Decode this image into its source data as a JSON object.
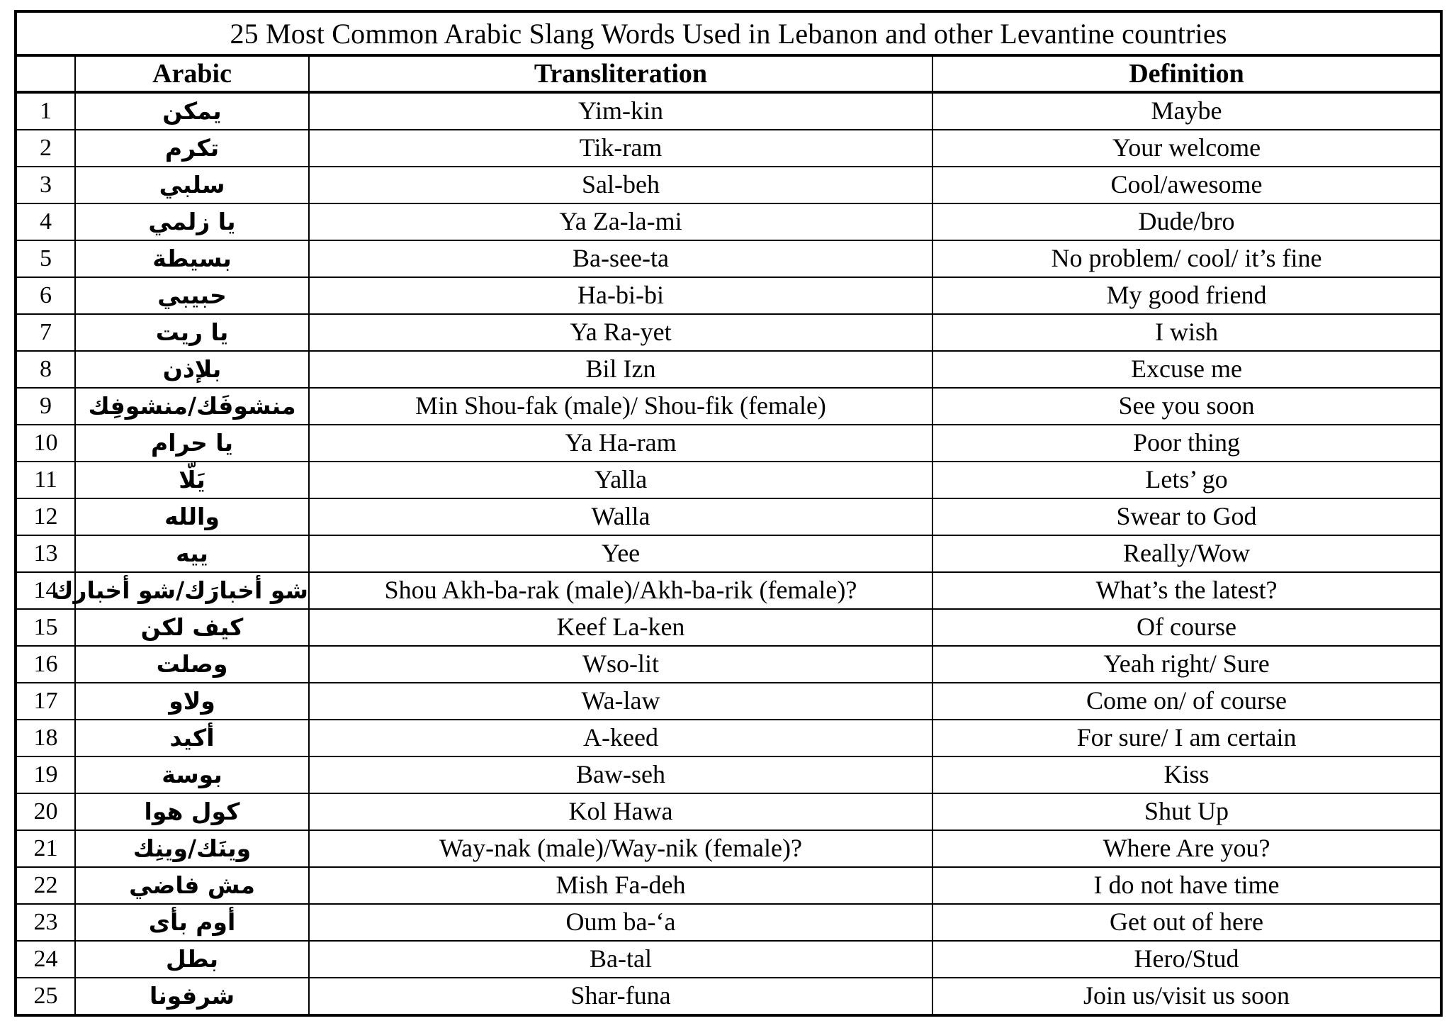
{
  "document": {
    "title": "25 Most Common Arabic Slang Words Used in Lebanon and other Levantine countries"
  },
  "table": {
    "headers": {
      "number": "",
      "arabic": "Arabic",
      "transliteration": "Transliteration",
      "definition": "Definition"
    },
    "rows": [
      {
        "num": "1",
        "arabic": "يمكن",
        "translit": "Yim-kin",
        "definition": "Maybe"
      },
      {
        "num": "2",
        "arabic": "تكرم",
        "translit": "Tik-ram",
        "definition": "Your welcome"
      },
      {
        "num": "3",
        "arabic": "سلبي",
        "translit": "Sal-beh",
        "definition": "Cool/awesome"
      },
      {
        "num": "4",
        "arabic": "يا زلمي",
        "translit": "Ya Za-la-mi",
        "definition": "Dude/bro"
      },
      {
        "num": "5",
        "arabic": "بسيطة",
        "translit": "Ba-see-ta",
        "definition": "No problem/ cool/ it’s fine"
      },
      {
        "num": "6",
        "arabic": "حبيبي",
        "translit": "Ha-bi-bi",
        "definition": "My good friend"
      },
      {
        "num": "7",
        "arabic": "يا ريت",
        "translit": "Ya Ra-yet",
        "definition": "I wish"
      },
      {
        "num": "8",
        "arabic": "بلإذن",
        "translit": "Bil Izn",
        "definition": "Excuse me"
      },
      {
        "num": "9",
        "arabic": "منشوفَك/منشوفِك",
        "translit": "Min Shou-fak (male)/ Shou-fik (female)",
        "definition": "See you soon"
      },
      {
        "num": "10",
        "arabic": "يا حرام",
        "translit": "Ya Ha-ram",
        "definition": "Poor thing"
      },
      {
        "num": "11",
        "arabic": "يَلّا",
        "translit": "Yalla",
        "definition": "Lets’ go"
      },
      {
        "num": "12",
        "arabic": "والله",
        "translit": "Walla",
        "definition": "Swear to God"
      },
      {
        "num": "13",
        "arabic": "ييه",
        "translit": "Yee",
        "definition": "Really/Wow"
      },
      {
        "num": "14",
        "arabic": "شو أخبارَك/شو أخبارك",
        "translit": "Shou Akh-ba-rak (male)/Akh-ba-rik (female)?",
        "definition": "What’s the latest?"
      },
      {
        "num": "15",
        "arabic": "كيف لكن",
        "translit": "Keef La-ken",
        "definition": "Of course"
      },
      {
        "num": "16",
        "arabic": "وصلت",
        "translit": "Wso-lit",
        "definition": "Yeah right/ Sure"
      },
      {
        "num": "17",
        "arabic": "ولاو",
        "translit": "Wa-law",
        "definition": "Come on/ of course"
      },
      {
        "num": "18",
        "arabic": "أكيد",
        "translit": "A-keed",
        "definition": "For sure/ I am certain"
      },
      {
        "num": "19",
        "arabic": "بوسة",
        "translit": "Baw-seh",
        "definition": "Kiss"
      },
      {
        "num": "20",
        "arabic": "كول هوا",
        "translit": "Kol Hawa",
        "definition": "Shut Up"
      },
      {
        "num": "21",
        "arabic": "وينَك/وينِك",
        "translit": "Way-nak (male)/Way-nik (female)?",
        "definition": "Where Are you?"
      },
      {
        "num": "22",
        "arabic": "مش فاضي",
        "translit": "Mish Fa-deh",
        "definition": "I do not have time"
      },
      {
        "num": "23",
        "arabic": "أوم بأى",
        "translit": "Oum ba-‘a",
        "definition": "Get out of here"
      },
      {
        "num": "24",
        "arabic": "بطل",
        "translit": "Ba-tal",
        "definition": "Hero/Stud"
      },
      {
        "num": "25",
        "arabic": "شرفونا",
        "translit": "Shar-funa",
        "definition": "Join us/visit us soon"
      }
    ]
  }
}
